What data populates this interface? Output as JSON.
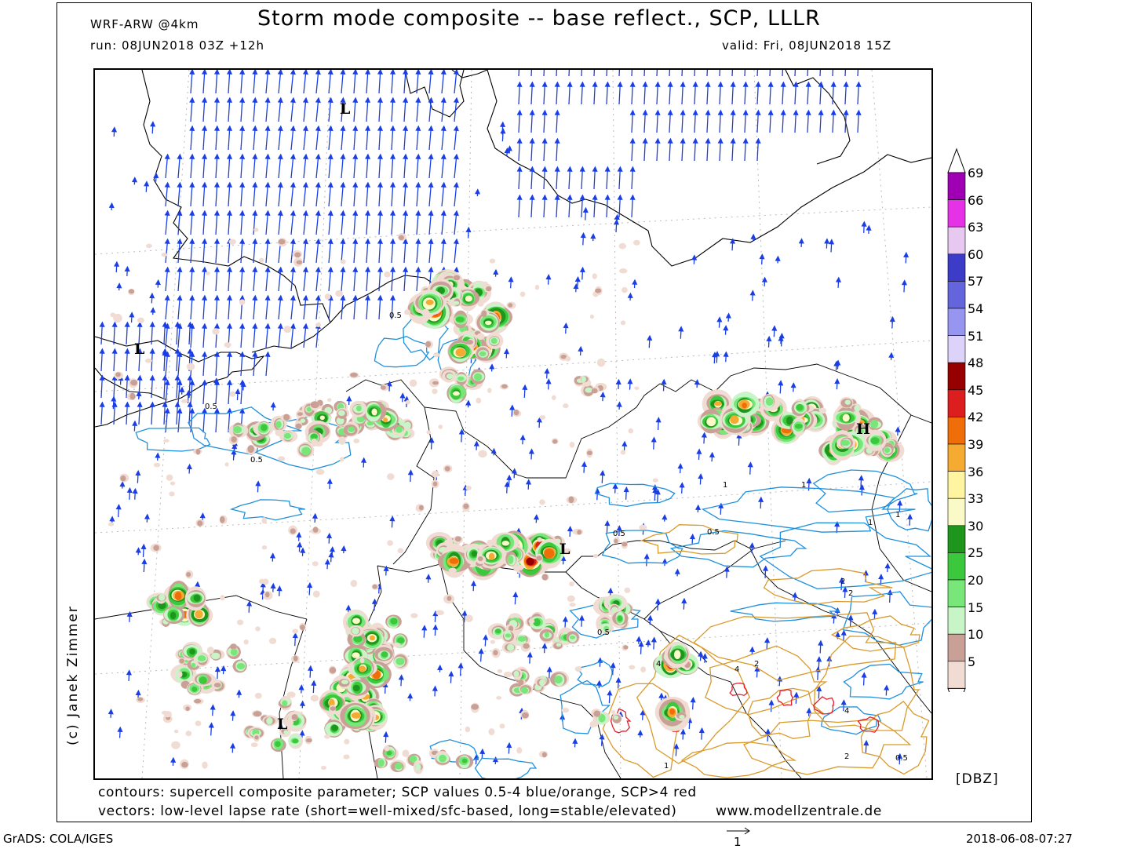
{
  "header": {
    "title": "Storm mode composite -- base reflect., SCP, LLLR",
    "model": "WRF-ARW @4km",
    "run": "run: 08JUN2018 03Z +12h",
    "valid": "valid: Fri, 08JUN2018 15Z"
  },
  "credit": "(c) Janek Zimmer",
  "map": {
    "pressure_centers": [
      {
        "label": "L",
        "name": "low-north-sea"
      },
      {
        "label": "L",
        "name": "low-channel"
      },
      {
        "label": "L",
        "name": "low-bay-of-biscay"
      },
      {
        "label": "L",
        "name": "low-south-france"
      },
      {
        "label": "L",
        "name": "low-alps"
      },
      {
        "label": "H",
        "name": "high-carpathians"
      }
    ],
    "contour_labels": [
      "0.5",
      "0.5",
      "0.5",
      "0.5",
      "0.5",
      "0.5",
      "1",
      "1",
      "1",
      "1",
      "2",
      "2",
      "2",
      "4",
      "4",
      "4",
      "2",
      "1",
      "0.5"
    ],
    "colors": {
      "vectors": "#1a3ee6",
      "scp_low": "#1e90dc",
      "scp_mid": "#d99a2b",
      "scp_high": "#e0202a",
      "coast": "#000000"
    }
  },
  "colorbar": {
    "unit": "[DBZ]",
    "labels": [
      "69",
      "66",
      "63",
      "60",
      "57",
      "54",
      "51",
      "48",
      "45",
      "42",
      "39",
      "36",
      "33",
      "30",
      "25",
      "20",
      "15",
      "10",
      "5"
    ],
    "colors": [
      "#a000b4",
      "#e632e6",
      "#e6c8f0",
      "#3c3cc8",
      "#6464dc",
      "#9696f0",
      "#dcd2fa",
      "#960000",
      "#dc1e1e",
      "#f06e0a",
      "#f5aa32",
      "#fff5a0",
      "#fafac8",
      "#1e961e",
      "#3cc83c",
      "#78e678",
      "#c8f5c8",
      "#c8a096",
      "#f0dcd2"
    ]
  },
  "footer": {
    "line1": "contours: supercell composite parameter; SCP values 0.5-4 blue/orange, SCP>4 red",
    "line2": "vectors: low-level lapse rate (short=well-mixed/sfc-based, long=stable/elevated)",
    "site": "www.modellzentrale.de",
    "grads": "GrADS: COLA/IGES",
    "scale_value": "1",
    "timestamp": "2018-06-08-07:27"
  }
}
